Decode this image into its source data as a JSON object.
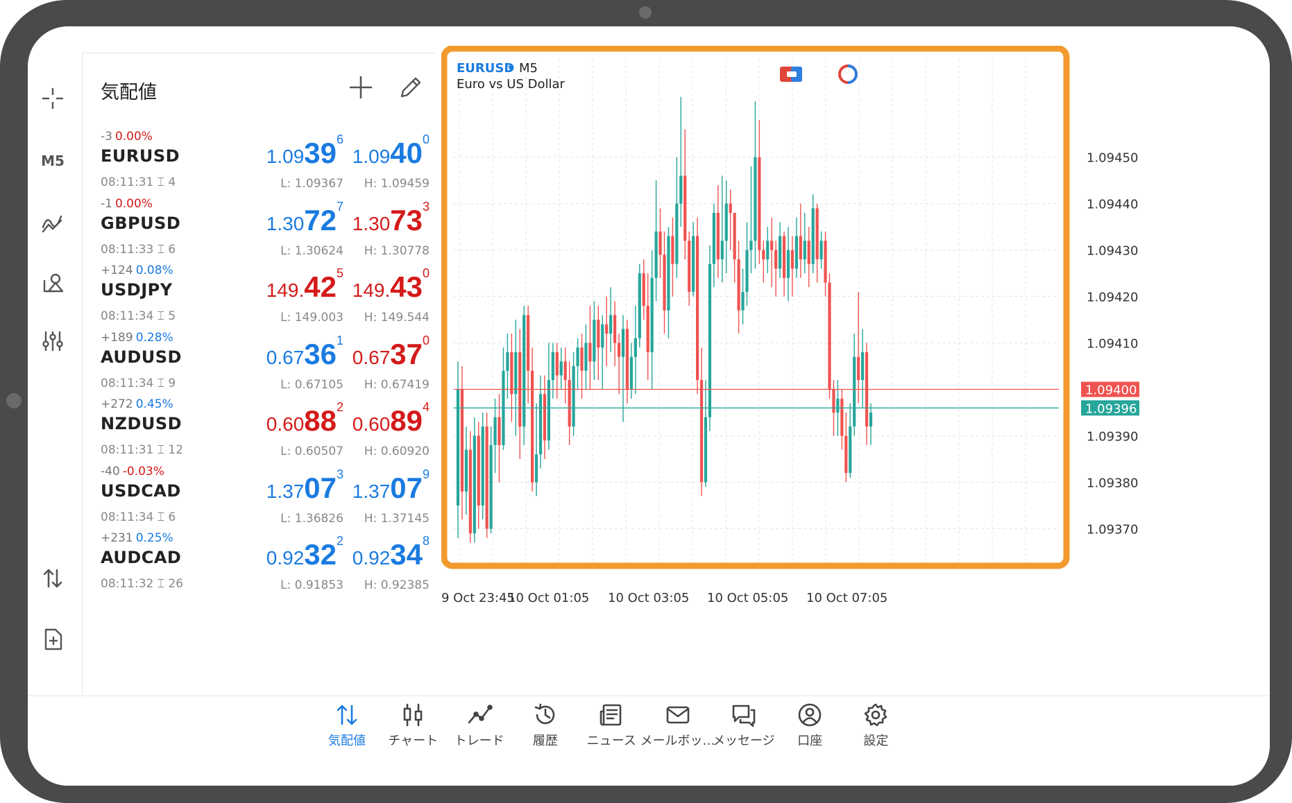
{
  "rail": {
    "timeframe": "M5",
    "tools": [
      "crosshair-icon",
      "indicators-icon",
      "objects-icon",
      "settings-sliders-icon",
      "sort-arrows-icon",
      "add-document-icon"
    ]
  },
  "quotes": {
    "title": "気配値",
    "rows": [
      {
        "change": "-3",
        "pct": "0.00%",
        "pct_color": "red",
        "symbol": "EURUSD",
        "time": "08:11:31",
        "spread": "4",
        "bid": {
          "s": "1.09",
          "b": "39",
          "x": "6",
          "color": "blue"
        },
        "ask": {
          "s": "1.09",
          "b": "40",
          "x": "0",
          "color": "blue"
        },
        "low": "L: 1.09367",
        "high": "H: 1.09459"
      },
      {
        "change": "-1",
        "pct": "0.00%",
        "pct_color": "red",
        "symbol": "GBPUSD",
        "time": "08:11:33",
        "spread": "6",
        "bid": {
          "s": "1.30",
          "b": "72",
          "x": "7",
          "color": "blue"
        },
        "ask": {
          "s": "1.30",
          "b": "73",
          "x": "3",
          "color": "red"
        },
        "low": "L: 1.30624",
        "high": "H: 1.30778"
      },
      {
        "change": "+124",
        "pct": "0.08%",
        "pct_color": "blue",
        "symbol": "USDJPY",
        "time": "08:11:34",
        "spread": "5",
        "bid": {
          "s": "149.",
          "b": "42",
          "x": "5",
          "color": "red"
        },
        "ask": {
          "s": "149.",
          "b": "43",
          "x": "0",
          "color": "red"
        },
        "low": "L: 149.003",
        "high": "H: 149.544"
      },
      {
        "change": "+189",
        "pct": "0.28%",
        "pct_color": "blue",
        "symbol": "AUDUSD",
        "time": "08:11:34",
        "spread": "9",
        "bid": {
          "s": "0.67",
          "b": "36",
          "x": "1",
          "color": "blue"
        },
        "ask": {
          "s": "0.67",
          "b": "37",
          "x": "0",
          "color": "red"
        },
        "low": "L: 0.67105",
        "high": "H: 0.67419"
      },
      {
        "change": "+272",
        "pct": "0.45%",
        "pct_color": "blue",
        "symbol": "NZDUSD",
        "time": "08:11:31",
        "spread": "12",
        "bid": {
          "s": "0.60",
          "b": "88",
          "x": "2",
          "color": "red"
        },
        "ask": {
          "s": "0.60",
          "b": "89",
          "x": "4",
          "color": "red"
        },
        "low": "L: 0.60507",
        "high": "H: 0.60920"
      },
      {
        "change": "-40",
        "pct": "-0.03%",
        "pct_color": "red",
        "symbol": "USDCAD",
        "time": "08:11:34",
        "spread": "6",
        "bid": {
          "s": "1.37",
          "b": "07",
          "x": "3",
          "color": "blue"
        },
        "ask": {
          "s": "1.37",
          "b": "07",
          "x": "9",
          "color": "blue"
        },
        "low": "L: 1.36826",
        "high": "H: 1.37145"
      },
      {
        "change": "+231",
        "pct": "0.25%",
        "pct_color": "blue",
        "symbol": "AUDCAD",
        "time": "08:11:32",
        "spread": "26",
        "bid": {
          "s": "0.92",
          "b": "32",
          "x": "2",
          "color": "blue"
        },
        "ask": {
          "s": "0.92",
          "b": "34",
          "x": "8",
          "color": "blue"
        },
        "low": "L: 0.91853",
        "high": "H: 0.92385"
      }
    ]
  },
  "chart": {
    "symbol": "EURUSD",
    "timeframe": "M5",
    "description": "Euro vs US Dollar",
    "highlight_color": "#f29a2e",
    "up_color": "#26a69a",
    "down_color": "#ef5350"
  },
  "chart_data": {
    "type": "candlestick",
    "ylim": [
      1.09362,
      1.09471
    ],
    "y_ticks": [
      "1.09450",
      "1.09440",
      "1.09430",
      "1.09420",
      "1.09410",
      "1.09390",
      "1.09380",
      "1.09370"
    ],
    "x_tick_labels": [
      "9 Oct 23:45",
      "10 Oct 01:05",
      "10 Oct 03:05",
      "10 Oct 05:05",
      "10 Oct 07:05"
    ],
    "ask_line": "1.09400",
    "bid_line": "1.09396",
    "candles": [
      [
        1.09375,
        1.094,
        1.09368,
        1.09406
      ],
      [
        1.094,
        1.09378,
        1.09372,
        1.09405
      ],
      [
        1.09378,
        1.09387,
        1.09373,
        1.09392
      ],
      [
        1.09387,
        1.09369,
        1.09367,
        1.09391
      ],
      [
        1.09369,
        1.0939,
        1.09367,
        1.09394
      ],
      [
        1.0939,
        1.09375,
        1.0937,
        1.09393
      ],
      [
        1.09375,
        1.09392,
        1.09372,
        1.09395
      ],
      [
        1.09392,
        1.0937,
        1.09368,
        1.09395
      ],
      [
        1.0937,
        1.09388,
        1.09369,
        1.09392
      ],
      [
        1.09388,
        1.09394,
        1.09382,
        1.09398
      ],
      [
        1.09394,
        1.09388,
        1.0938,
        1.09399
      ],
      [
        1.09388,
        1.09404,
        1.09387,
        1.09409
      ],
      [
        1.09404,
        1.09408,
        1.09398,
        1.09412
      ],
      [
        1.09408,
        1.09399,
        1.09393,
        1.09412
      ],
      [
        1.09399,
        1.09408,
        1.0939,
        1.09415
      ],
      [
        1.09408,
        1.09392,
        1.09385,
        1.09413
      ],
      [
        1.09392,
        1.09416,
        1.09388,
        1.09418
      ],
      [
        1.09416,
        1.09404,
        1.09397,
        1.09418
      ],
      [
        1.09404,
        1.0938,
        1.09378,
        1.09409
      ],
      [
        1.0938,
        1.09386,
        1.09377,
        1.09397
      ],
      [
        1.09386,
        1.09399,
        1.09383,
        1.09403
      ],
      [
        1.09399,
        1.09389,
        1.09385,
        1.09403
      ],
      [
        1.09389,
        1.09402,
        1.09387,
        1.0941
      ],
      [
        1.09402,
        1.09408,
        1.09398,
        1.0941
      ],
      [
        1.09408,
        1.09403,
        1.09398,
        1.0941
      ],
      [
        1.09403,
        1.09406,
        1.094,
        1.09409
      ],
      [
        1.09406,
        1.09402,
        1.09397,
        1.09409
      ],
      [
        1.09402,
        1.09392,
        1.09388,
        1.09406
      ],
      [
        1.09392,
        1.09405,
        1.0939,
        1.09408
      ],
      [
        1.09405,
        1.09409,
        1.094,
        1.09411
      ],
      [
        1.09409,
        1.09404,
        1.09398,
        1.09412
      ],
      [
        1.09404,
        1.0941,
        1.094,
        1.09414
      ],
      [
        1.0941,
        1.09406,
        1.094,
        1.09418
      ],
      [
        1.09406,
        1.09415,
        1.09402,
        1.09419
      ],
      [
        1.09415,
        1.09409,
        1.09402,
        1.09418
      ],
      [
        1.09409,
        1.09414,
        1.094,
        1.09416
      ],
      [
        1.09414,
        1.09412,
        1.09405,
        1.0942
      ],
      [
        1.09412,
        1.09416,
        1.09408,
        1.09422
      ],
      [
        1.09416,
        1.0941,
        1.09405,
        1.09419
      ],
      [
        1.0941,
        1.09407,
        1.09399,
        1.09412
      ],
      [
        1.09407,
        1.09413,
        1.09393,
        1.09416
      ],
      [
        1.09413,
        1.094,
        1.09397,
        1.09415
      ],
      [
        1.094,
        1.09407,
        1.09398,
        1.0941
      ],
      [
        1.09407,
        1.09411,
        1.09399,
        1.09418
      ],
      [
        1.09411,
        1.09425,
        1.09409,
        1.09427
      ],
      [
        1.09425,
        1.09418,
        1.09415,
        1.09428
      ],
      [
        1.09418,
        1.09408,
        1.09402,
        1.09425
      ],
      [
        1.09408,
        1.09424,
        1.094,
        1.0943
      ],
      [
        1.09424,
        1.09434,
        1.09419,
        1.09445
      ],
      [
        1.09434,
        1.09429,
        1.09424,
        1.09439
      ],
      [
        1.09429,
        1.09417,
        1.09412,
        1.09434
      ],
      [
        1.09417,
        1.09433,
        1.09411,
        1.09435
      ],
      [
        1.09433,
        1.09427,
        1.0942,
        1.09437
      ],
      [
        1.09427,
        1.0944,
        1.09424,
        1.0945
      ],
      [
        1.0944,
        1.09446,
        1.09435,
        1.09463
      ],
      [
        1.09446,
        1.09432,
        1.09428,
        1.09456
      ],
      [
        1.09432,
        1.09421,
        1.09418,
        1.09434
      ],
      [
        1.09421,
        1.09433,
        1.0942,
        1.09436
      ],
      [
        1.09433,
        1.09402,
        1.09399,
        1.09437
      ],
      [
        1.09402,
        1.0938,
        1.09377,
        1.09409
      ],
      [
        1.0938,
        1.09394,
        1.09379,
        1.09402
      ],
      [
        1.09394,
        1.09427,
        1.09391,
        1.09431
      ],
      [
        1.09427,
        1.09438,
        1.09422,
        1.0944
      ],
      [
        1.09438,
        1.09428,
        1.09424,
        1.09444
      ],
      [
        1.09428,
        1.09432,
        1.09423,
        1.09446
      ],
      [
        1.09432,
        1.0944,
        1.09425,
        1.09445
      ],
      [
        1.0944,
        1.09438,
        1.0943,
        1.09443
      ],
      [
        1.09438,
        1.09428,
        1.09423,
        1.09436
      ],
      [
        1.09428,
        1.09417,
        1.09412,
        1.09432
      ],
      [
        1.09417,
        1.09421,
        1.09414,
        1.09426
      ],
      [
        1.09421,
        1.0943,
        1.09418,
        1.09436
      ],
      [
        1.0943,
        1.09432,
        1.09425,
        1.09448
      ],
      [
        1.09432,
        1.0945,
        1.09426,
        1.09462
      ],
      [
        1.0945,
        1.0943,
        1.09427,
        1.09458
      ],
      [
        1.0943,
        1.09428,
        1.09423,
        1.09432
      ],
      [
        1.09428,
        1.09432,
        1.09425,
        1.09435
      ],
      [
        1.09432,
        1.0943,
        1.09422,
        1.09437
      ],
      [
        1.0943,
        1.09426,
        1.0942,
        1.09432
      ],
      [
        1.09426,
        1.09433,
        1.09424,
        1.09436
      ],
      [
        1.09433,
        1.09424,
        1.0942,
        1.09434
      ],
      [
        1.09424,
        1.0943,
        1.09419,
        1.09435
      ],
      [
        1.0943,
        1.09426,
        1.0942,
        1.09433
      ],
      [
        1.09426,
        1.09433,
        1.09424,
        1.09437
      ],
      [
        1.09433,
        1.09428,
        1.09424,
        1.0944
      ],
      [
        1.09428,
        1.09432,
        1.09425,
        1.09438
      ],
      [
        1.09432,
        1.09427,
        1.09422,
        1.09435
      ],
      [
        1.09427,
        1.09439,
        1.09425,
        1.09442
      ],
      [
        1.09439,
        1.09428,
        1.09423,
        1.0944
      ],
      [
        1.09428,
        1.09432,
        1.09426,
        1.09434
      ],
      [
        1.09432,
        1.09423,
        1.0942,
        1.09434
      ],
      [
        1.09423,
        1.094,
        1.09398,
        1.09425
      ],
      [
        1.094,
        1.09395,
        1.0939,
        1.09402
      ],
      [
        1.09395,
        1.09398,
        1.0939,
        1.09402
      ],
      [
        1.09398,
        1.0939,
        1.09387,
        1.094
      ],
      [
        1.0939,
        1.09382,
        1.0938,
        1.09395
      ],
      [
        1.09382,
        1.09392,
        1.09381,
        1.09397
      ],
      [
        1.09392,
        1.09407,
        1.0939,
        1.09412
      ],
      [
        1.09407,
        1.09402,
        1.09397,
        1.09421
      ],
      [
        1.09402,
        1.09408,
        1.09396,
        1.09413
      ],
      [
        1.09408,
        1.09392,
        1.09388,
        1.0941
      ],
      [
        1.09392,
        1.09395,
        1.09388,
        1.09397
      ]
    ]
  },
  "nav": [
    {
      "label": "気配値",
      "icon": "quotes-arrows-icon",
      "active": true
    },
    {
      "label": "チャート",
      "icon": "candles-icon",
      "active": false
    },
    {
      "label": "トレード",
      "icon": "trade-line-icon",
      "active": false
    },
    {
      "label": "履歴",
      "icon": "history-clock-icon",
      "active": false
    },
    {
      "label": "ニュース",
      "icon": "news-icon",
      "active": false
    },
    {
      "label": "メールボッ…",
      "icon": "mail-icon",
      "active": false
    },
    {
      "label": "メッセージ",
      "icon": "chat-bubbles-icon",
      "active": false
    },
    {
      "label": "口座",
      "icon": "account-icon",
      "active": false
    },
    {
      "label": "設定",
      "icon": "gear-icon",
      "active": false
    }
  ]
}
